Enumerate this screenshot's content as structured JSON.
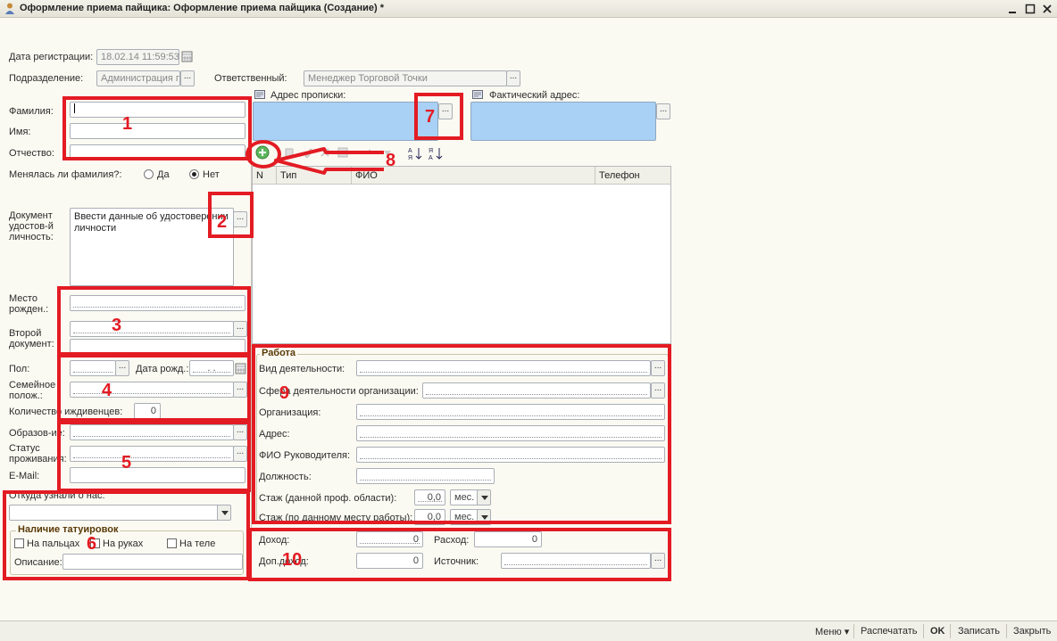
{
  "window": {
    "title": "Оформление приема пайщика: Оформление приема пайщика (Создание) *"
  },
  "form": {
    "reg_date_label": "Дата регистрации:",
    "reg_date_value": "18.02.14 11:59:53",
    "division_label": "Подразделение:",
    "division_value": "Администрация г",
    "responsible_label": "Ответственный:",
    "responsible_value": "Менеджер Торговой Точки",
    "surname_label": "Фамилия:",
    "name_label": "Имя:",
    "patronymic_label": "Отчество:",
    "surname_changed_label": "Менялась ли фамилия?:",
    "radio_yes": "Да",
    "radio_no": "Нет",
    "id_doc_label": "Документ удостов-й личность:",
    "id_doc_value": "Ввести данные об удостоверении личности",
    "birthplace_label": "Место рожден.:",
    "second_doc_label": "Второй документ:",
    "gender_label": "Пол:",
    "birthdate_label": "Дата рожд.:",
    "birthdate_value": ". .",
    "marital_label": "Семейное полож.:",
    "dependents_label": "Количество иждивенцев:",
    "dependents_value": "0",
    "education_label": "Образов-ие:",
    "residence_label": "Статус проживания:",
    "email_label": "E-Mail:",
    "source_label": "Откуда узнали о нас:",
    "tattoo_group": "Наличие татуировок",
    "tattoo_fingers": "На пальцах",
    "tattoo_hands": "На руках",
    "tattoo_body": "На теле",
    "description_label": "Описание:",
    "reg_address_label": "Адрес прописки:",
    "actual_address_label": "Фактический адрес:"
  },
  "contacts_table": {
    "columns": [
      "N",
      "Тип",
      "ФИО",
      "Телефон"
    ]
  },
  "work": {
    "group_title": "Работа",
    "activity_label": "Вид деятельности:",
    "org_sphere_label": "Сфера деятельности организации:",
    "organization_label": "Организация:",
    "address_label": "Адрес:",
    "manager_label": "ФИО Руководителя:",
    "position_label": "Должность:",
    "exp_field_label": "Стаж (данной проф. области):",
    "exp_field_value": "0,0",
    "exp_field_unit": "мес.",
    "exp_place_label": "Стаж (по данному месту работы):",
    "exp_place_value": "0,0",
    "exp_place_unit": "мес."
  },
  "finance": {
    "income_label": "Доход:",
    "income_value": "0",
    "expense_label": "Расход:",
    "expense_value": "0",
    "extra_income_label": "Доп.доход:",
    "extra_income_value": "0",
    "source_label": "Источник:"
  },
  "annotations": [
    "1",
    "2",
    "3",
    "4",
    "5",
    "6",
    "7",
    "8",
    "9",
    "10"
  ],
  "footer": {
    "menu": "Меню",
    "print": "Распечатать",
    "ok": "OK",
    "save": "Записать",
    "close": "Закрыть"
  },
  "colors": {
    "annotation_red": "#e31b23",
    "address_blue": "#a9d0f5",
    "background": "#fbfaf2"
  }
}
